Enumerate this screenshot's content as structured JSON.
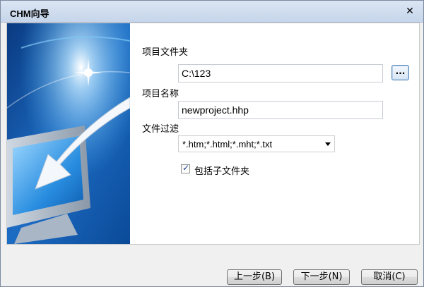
{
  "window": {
    "title": "CHM向导"
  },
  "form": {
    "project_folder_label": "项目文件夹",
    "project_folder_value": "C:\\123",
    "browse_label": "...",
    "project_name_label": "项目名称",
    "project_name_value": "newproject.hhp",
    "file_filter_label": "文件过滤",
    "file_filter_value": "*.htm;*.html;*.mht;*.txt",
    "include_subfolders_label": "包括子文件夹",
    "include_subfolders_checked": true
  },
  "footer": {
    "back_label": "上一步(B)",
    "next_label": "下一步(N)",
    "cancel_label": "取消(C)"
  },
  "colors": {
    "side_dark": "#0a3f86",
    "side_light": "#3fa2e6",
    "accent_border": "#5a88b8"
  },
  "icons": {
    "close": "close-icon",
    "dropdown": "dropdown-arrow-icon",
    "check": "check-icon",
    "monitor": "monitor-icon",
    "arrow": "arrow-icon"
  }
}
